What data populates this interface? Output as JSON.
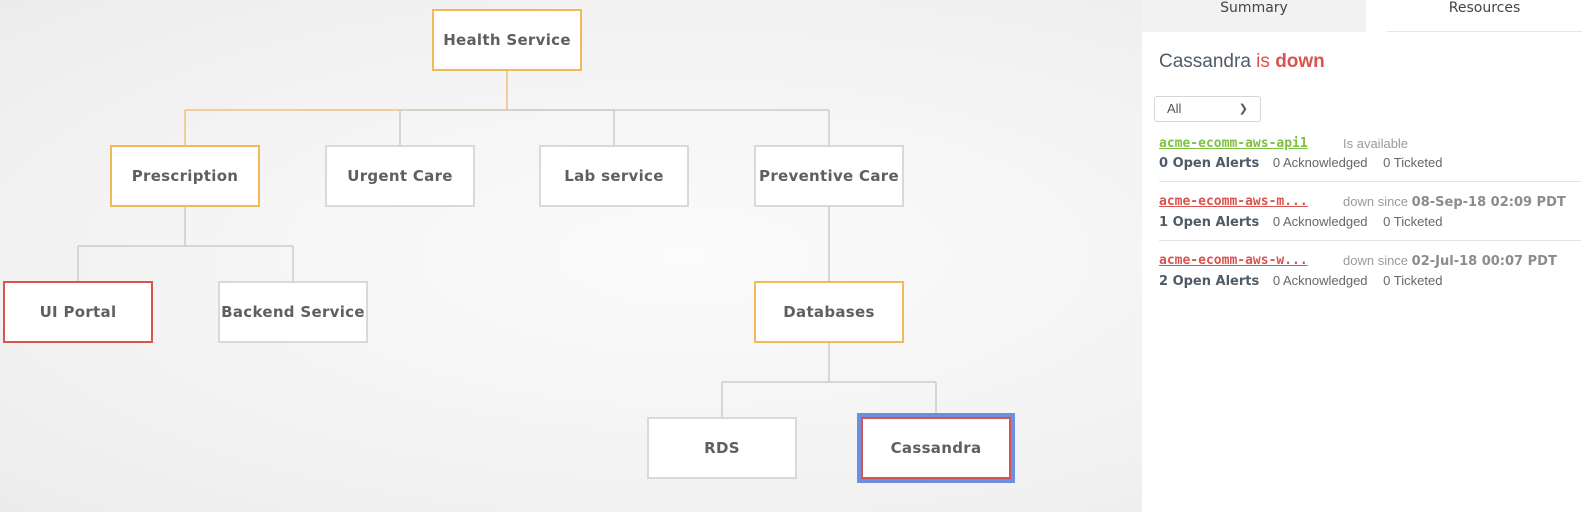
{
  "diagram": {
    "nodes": [
      {
        "id": "health-service",
        "label": "Health Service",
        "status": "warn"
      },
      {
        "id": "prescription",
        "label": "Prescription",
        "status": "warn"
      },
      {
        "id": "urgent-care",
        "label": "Urgent Care",
        "status": "ok"
      },
      {
        "id": "lab-service",
        "label": "Lab service",
        "status": "ok"
      },
      {
        "id": "preventive-care",
        "label": "Preventive Care",
        "status": "ok"
      },
      {
        "id": "ui-portal",
        "label": "UI Portal",
        "status": "down"
      },
      {
        "id": "backend-service",
        "label": "Backend Service",
        "status": "ok"
      },
      {
        "id": "databases",
        "label": "Databases",
        "status": "warn"
      },
      {
        "id": "rds",
        "label": "RDS",
        "status": "ok"
      },
      {
        "id": "cassandra",
        "label": "Cassandra",
        "status": "down",
        "selected": true
      }
    ],
    "edges": [
      {
        "from": "health-service",
        "to": "prescription",
        "highlight": true
      },
      {
        "from": "health-service",
        "to": "urgent-care"
      },
      {
        "from": "health-service",
        "to": "lab-service"
      },
      {
        "from": "health-service",
        "to": "preventive-care"
      },
      {
        "from": "prescription",
        "to": "ui-portal"
      },
      {
        "from": "prescription",
        "to": "backend-service"
      },
      {
        "from": "preventive-care",
        "to": "databases"
      },
      {
        "from": "databases",
        "to": "rds"
      },
      {
        "from": "databases",
        "to": "cassandra"
      }
    ],
    "colors": {
      "warn": "#f0b95a",
      "down": "#d9534f",
      "ok": "#d9d9d9",
      "selected": "#6c8fe0",
      "edge": "#cccccc",
      "edge_highlight": "#f0c27a"
    }
  },
  "panel": {
    "tabs": [
      {
        "label": "Summary",
        "active": false
      },
      {
        "label": "Resources",
        "active": true
      }
    ],
    "heading": {
      "name": "Cassandra",
      "is": "is",
      "state": "down"
    },
    "filter": {
      "selected": "All"
    },
    "resources": [
      {
        "name": "acme-ecomm-aws-api1",
        "status_kind": "ok",
        "status_text": "Is available",
        "since": "",
        "open_alerts": "0 Open Alerts",
        "acknowledged": "0 Acknowledged",
        "ticketed": "0 Ticketed"
      },
      {
        "name": "acme-ecomm-aws-m...",
        "status_kind": "bad",
        "status_text": "down since",
        "since": "08-Sep-18 02:09 PDT",
        "open_alerts": "1 Open Alerts",
        "acknowledged": "0 Acknowledged",
        "ticketed": "0 Ticketed"
      },
      {
        "name": "acme-ecomm-aws-w...",
        "status_kind": "bad",
        "status_text": "down since",
        "since": "02-Jul-18 00:07 PDT",
        "open_alerts": "2 Open Alerts",
        "acknowledged": "0 Acknowledged",
        "ticketed": "0 Ticketed"
      }
    ]
  }
}
